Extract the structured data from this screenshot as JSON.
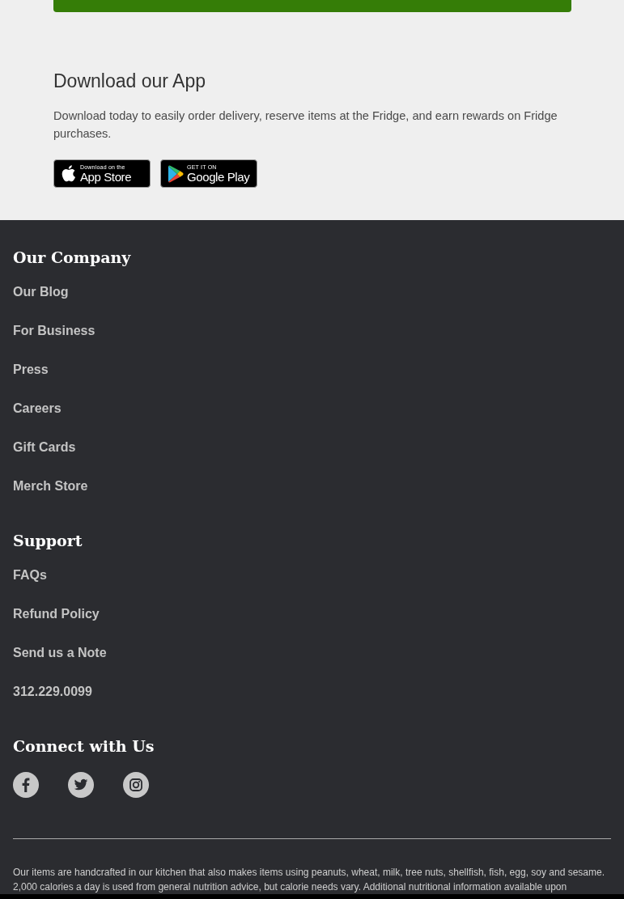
{
  "app_section": {
    "title": "Download our App",
    "text": "Download today to easily order delivery, reserve items at the Fridge, and earn rewards on Fridge purchases.",
    "badges": [
      {
        "kind": "apple",
        "small": "Download on the",
        "large": "App Store"
      },
      {
        "kind": "google",
        "small": "GET IT ON",
        "large": "Google Play"
      }
    ]
  },
  "footer": {
    "sections": [
      {
        "title": "Our Company",
        "links": [
          "Our Blog",
          "For Business",
          "Press",
          "Careers",
          "Gift Cards",
          "Merch Store"
        ]
      },
      {
        "title": "Support",
        "links": [
          "FAQs",
          "Refund Policy",
          "Send us a Note",
          "312.229.0099"
        ]
      }
    ],
    "connect": {
      "title": "Connect with Us",
      "socials": [
        {
          "kind": "facebook"
        },
        {
          "kind": "twitter"
        },
        {
          "kind": "instagram"
        }
      ]
    },
    "disclaimer": "Our items are handcrafted in our kitchen that also makes items using peanuts, wheat, milk, tree nuts, shellfish, fish, egg, soy and sesame. 2,000 calories a day is used from general nutrition advice, but calorie needs vary. Additional nutritional information available upon"
  }
}
